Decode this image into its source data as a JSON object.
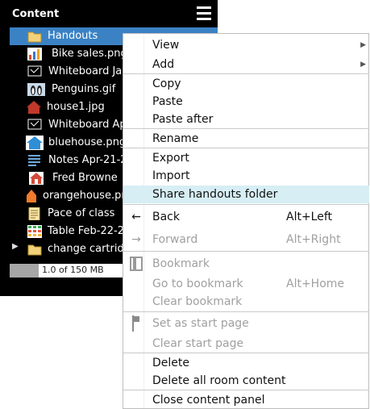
{
  "panel": {
    "title": "Content",
    "items": [
      {
        "label": "Handouts",
        "icon": "folder-icon",
        "selected": true
      },
      {
        "label": "Bike sales.png",
        "icon": "chart-image-icon"
      },
      {
        "label": "Whiteboard Ja",
        "icon": "whiteboard-icon"
      },
      {
        "label": "Penguins.gif",
        "icon": "penguins-image-icon"
      },
      {
        "label": "house1.jpg",
        "icon": "house-image-icon"
      },
      {
        "label": "Whiteboard Ap",
        "icon": "whiteboard-icon"
      },
      {
        "label": "bluehouse.png",
        "icon": "blue-house-icon"
      },
      {
        "label": "Notes Apr-21-2",
        "icon": "notes-icon"
      },
      {
        "label": "Fred Browne",
        "icon": "fred-house-icon"
      },
      {
        "label": "orangehouse.pn",
        "icon": "orange-house-icon"
      },
      {
        "label": "Pace of class",
        "icon": "document-icon"
      },
      {
        "label": "Table Feb-22-2",
        "icon": "table-icon"
      },
      {
        "label": "change cartrid",
        "icon": "folder-icon"
      }
    ],
    "storage": {
      "text": "1.0 of 150 MB",
      "used_fraction": 0.007
    }
  },
  "context_menu": {
    "items": [
      {
        "label": "View",
        "submenu": true
      },
      {
        "label": "Add",
        "submenu": true
      },
      {
        "label": "Copy"
      },
      {
        "label": "Paste"
      },
      {
        "label": "Paste after"
      },
      {
        "label": "Rename"
      },
      {
        "label": "Export"
      },
      {
        "label": "Import"
      },
      {
        "label": "Share handouts folder",
        "highlighted": true
      },
      {
        "label": "Back",
        "shortcut": "Alt+Left",
        "icon": "back-arrow-icon"
      },
      {
        "label": "Forward",
        "shortcut": "Alt+Right",
        "icon": "forward-arrow-icon",
        "disabled": true
      },
      {
        "label": "Bookmark",
        "icon": "bookmark-icon",
        "disabled": true
      },
      {
        "label": "Go to bookmark",
        "shortcut": "Alt+Home",
        "disabled": true
      },
      {
        "label": "Clear bookmark",
        "disabled": true
      },
      {
        "label": "Set as start page",
        "icon": "flag-icon",
        "disabled": true
      },
      {
        "label": "Clear start page",
        "disabled": true
      },
      {
        "label": "Delete"
      },
      {
        "label": "Delete all room content"
      },
      {
        "label": "Close content panel"
      }
    ]
  },
  "colors": {
    "selection": "#3b82c4",
    "highlight": "#d7eef5",
    "panel_bg": "#000000",
    "disabled": "#a0a0a0"
  }
}
